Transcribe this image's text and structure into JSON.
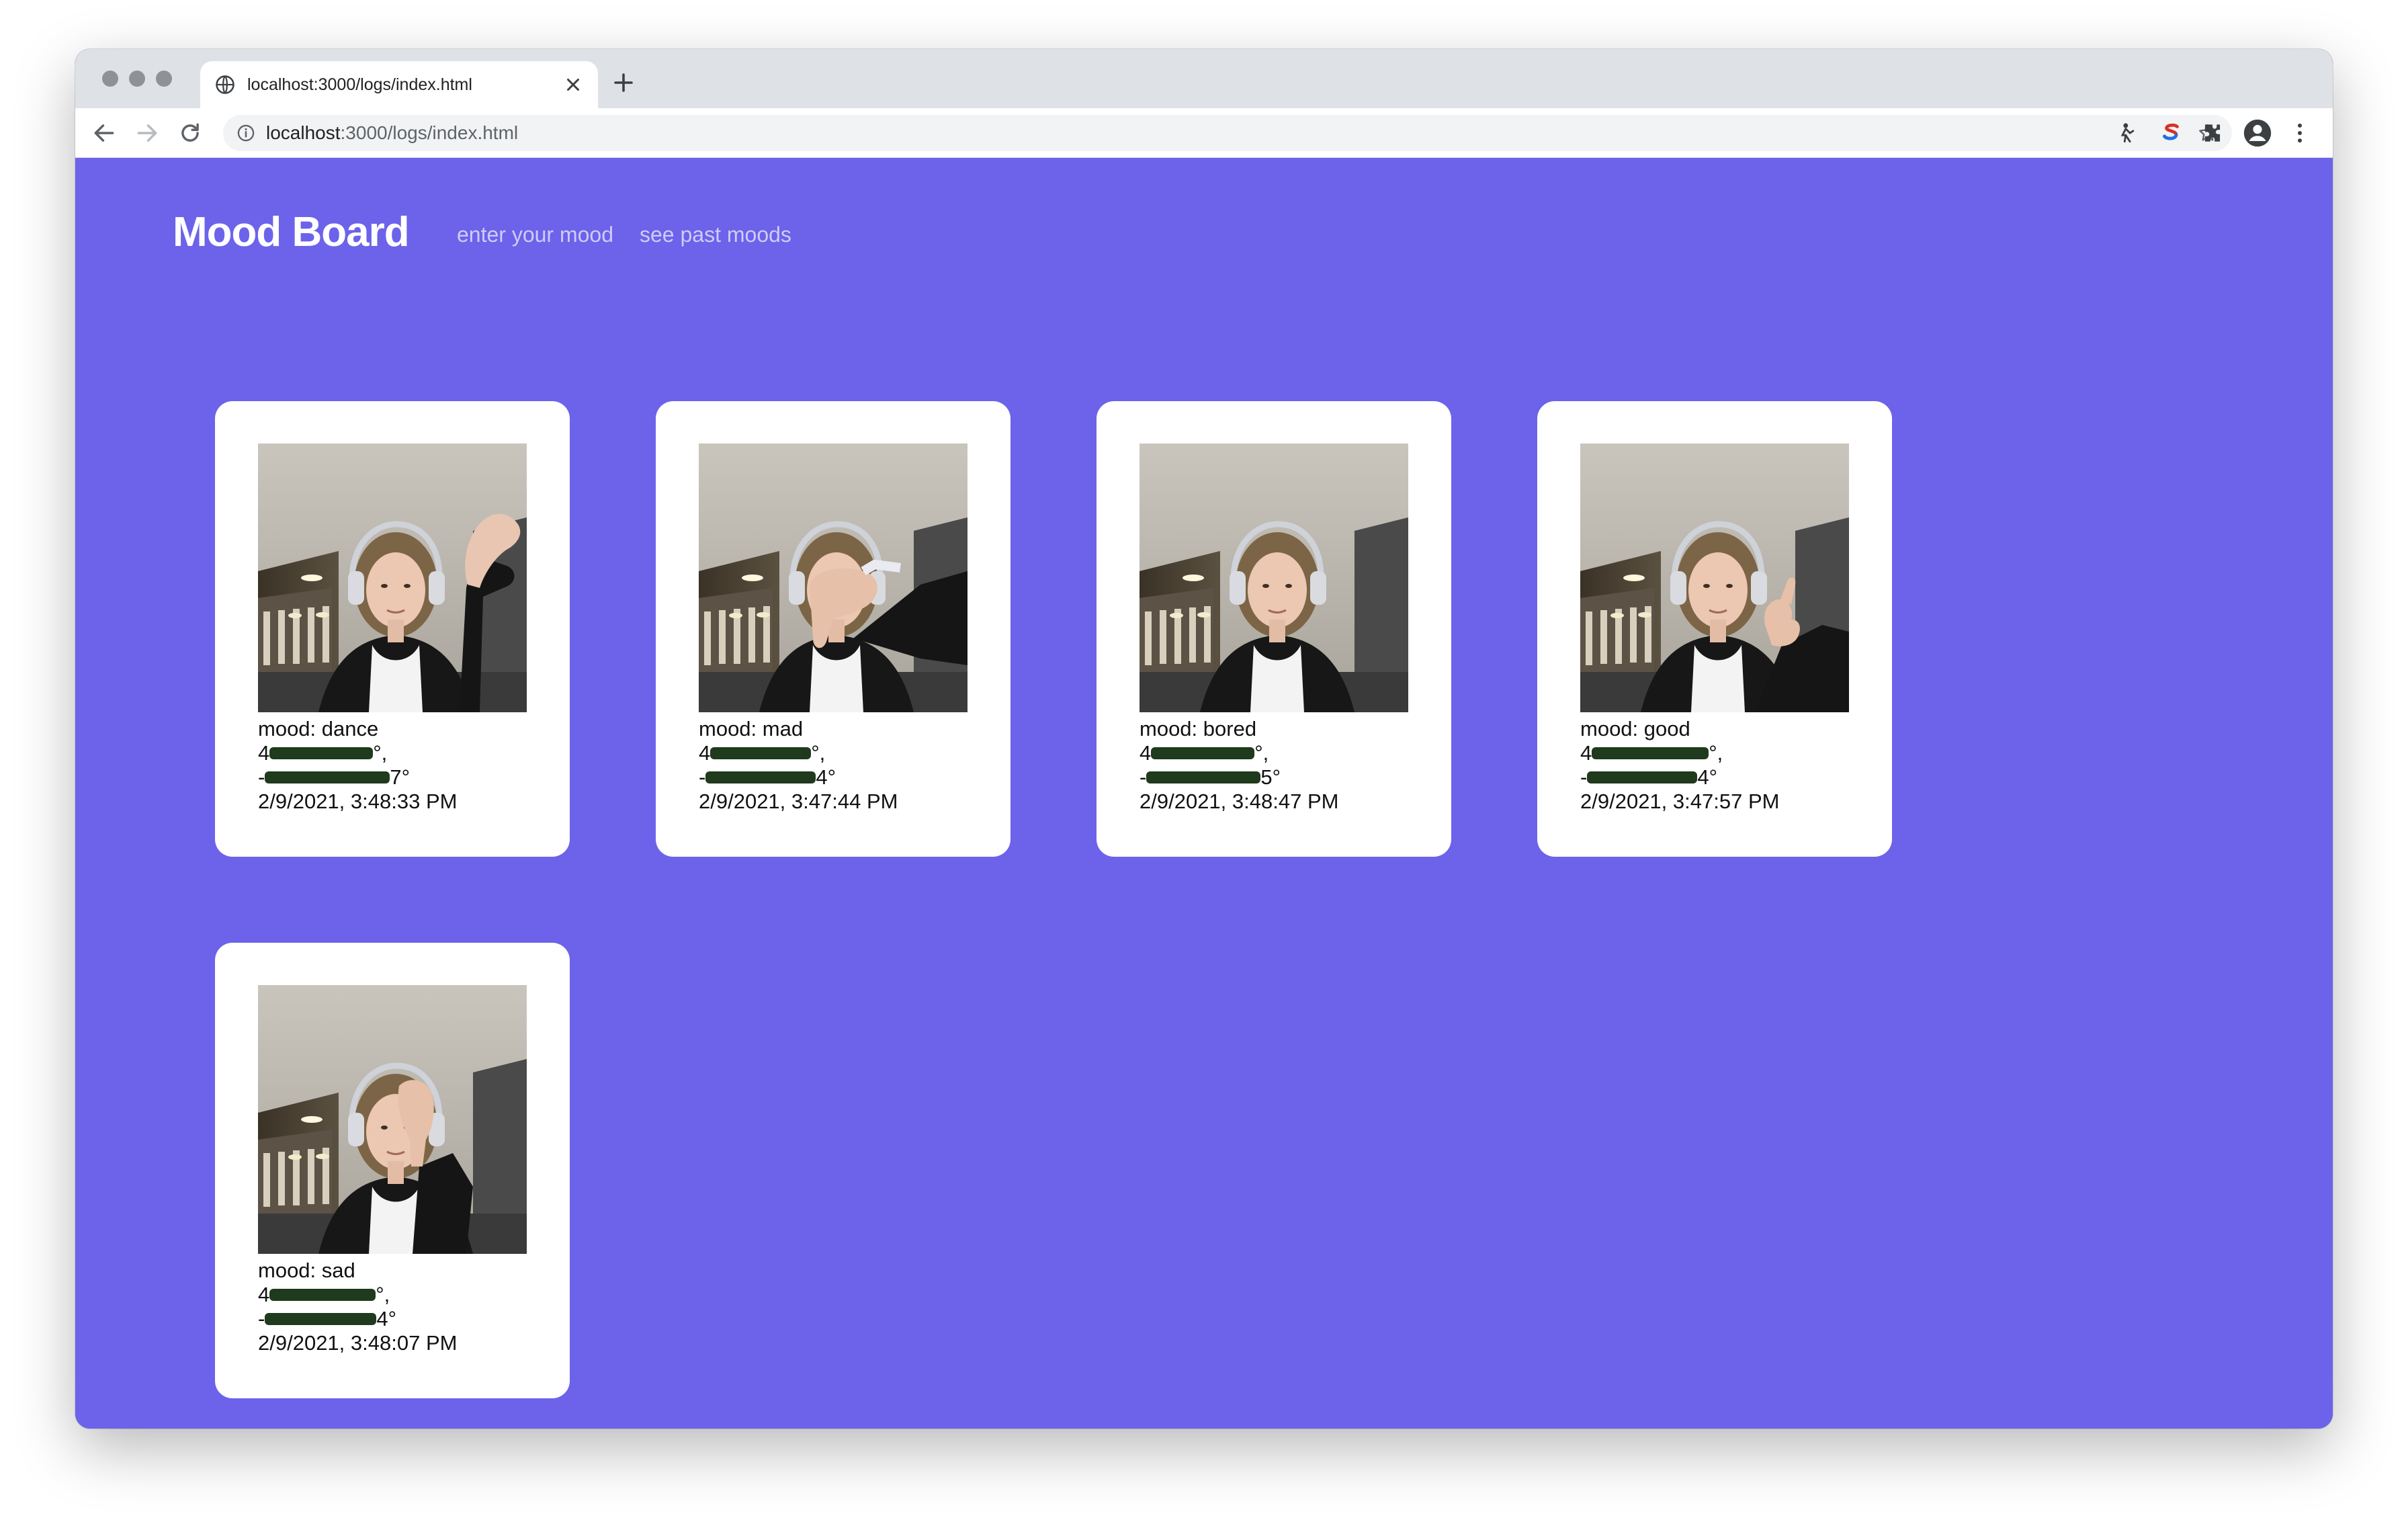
{
  "browser": {
    "tab_title": "localhost:3000/logs/index.html",
    "url_host": "localhost",
    "url_path": ":3000/logs/index.html"
  },
  "site": {
    "brand": "Mood Board",
    "nav": [
      {
        "label": "enter your mood"
      },
      {
        "label": "see past moods"
      }
    ]
  },
  "moods": [
    {
      "mood": "mood: dance",
      "lat_prefix": "4",
      "lat_suffix": "°,",
      "lon_prefix": "-",
      "lon_suffix": "7°",
      "date": "2/9/2021, 3:48:33 PM",
      "gesture": "wave"
    },
    {
      "mood": "mood: mad",
      "lat_prefix": "4",
      "lat_suffix": "°,",
      "lon_prefix": "-",
      "lon_suffix": "4°",
      "date": "2/9/2021, 3:47:44 PM",
      "gesture": "thumbs-down"
    },
    {
      "mood": "mood: bored",
      "lat_prefix": "4",
      "lat_suffix": "°,",
      "lon_prefix": "-",
      "lon_suffix": "5°",
      "date": "2/9/2021, 3:48:47 PM",
      "gesture": "none"
    },
    {
      "mood": "mood: good",
      "lat_prefix": "4",
      "lat_suffix": "°,",
      "lon_prefix": "-",
      "lon_suffix": "4°",
      "date": "2/9/2021, 3:47:57 PM",
      "gesture": "thumbs-up"
    },
    {
      "mood": "mood: sad",
      "lat_prefix": "4",
      "lat_suffix": "°,",
      "lon_prefix": "-",
      "lon_suffix": "4°",
      "date": "2/9/2021, 3:48:07 PM",
      "gesture": "hand-to-eye"
    }
  ],
  "colors": {
    "page_bg": "#6c63ea",
    "card_bg": "#ffffff",
    "redaction": "#1f3a1c",
    "nav_link": "#cfcbf9"
  }
}
